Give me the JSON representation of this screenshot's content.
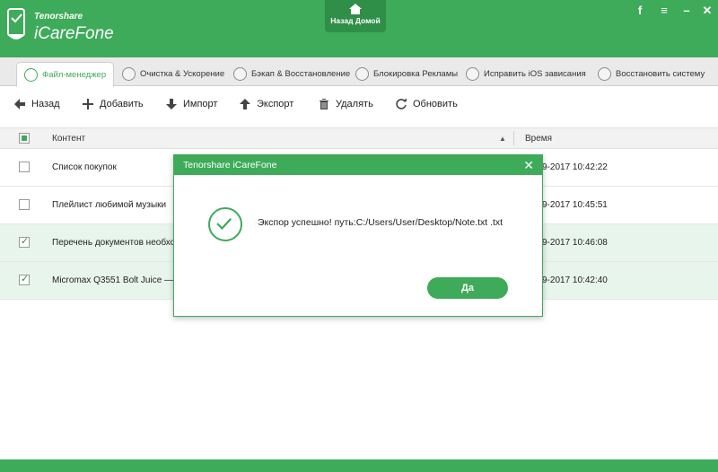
{
  "app": {
    "brand_small": "Tenorshare",
    "brand_name": "iCareFone",
    "home_button": "Назад Домой",
    "controls": {
      "facebook": "f",
      "menu": "≡",
      "minimize": "–",
      "close": "✕"
    },
    "accent_color": "#3eab5a"
  },
  "tabs": [
    {
      "label": "Файл-менеджер",
      "icon": "file-manager-icon",
      "active": true
    },
    {
      "label": "Очистка & Ускорение",
      "icon": "rocket-icon"
    },
    {
      "label": "Бэкап & Восстановление",
      "icon": "backup-icon"
    },
    {
      "label": "Блокировка Рекламы",
      "icon": "ad-block-icon"
    },
    {
      "label": "Исправить iOS зависания",
      "icon": "repair-icon"
    },
    {
      "label": "Восстановить систему",
      "icon": "wrench-icon"
    }
  ],
  "toolbar": {
    "back": "Назад",
    "add": "Добавить",
    "import": "Импорт",
    "export": "Экспорт",
    "delete": "Удалять",
    "refresh": "Обновить"
  },
  "table": {
    "col_content": "Контент",
    "col_time": "Время",
    "rows": [
      {
        "name": "Список покупок",
        "time": "9-2017 10:42:22",
        "checked": false
      },
      {
        "name": "Плейлист любимой музыки",
        "time": "9-2017 10:45:51",
        "checked": false
      },
      {
        "name": "Перечень документов необхо",
        "time": "9-2017 10:46:08",
        "checked": true
      },
      {
        "name": "Micromax Q3551 Bolt Juice — c",
        "time": "9-2017 10:42:40",
        "checked": true
      }
    ]
  },
  "dialog": {
    "title": "Tenorshare iCareFone",
    "message": "Экспор успешно! путь:C:/Users/User/Desktop/Note.txt .txt",
    "ok": "Да"
  }
}
